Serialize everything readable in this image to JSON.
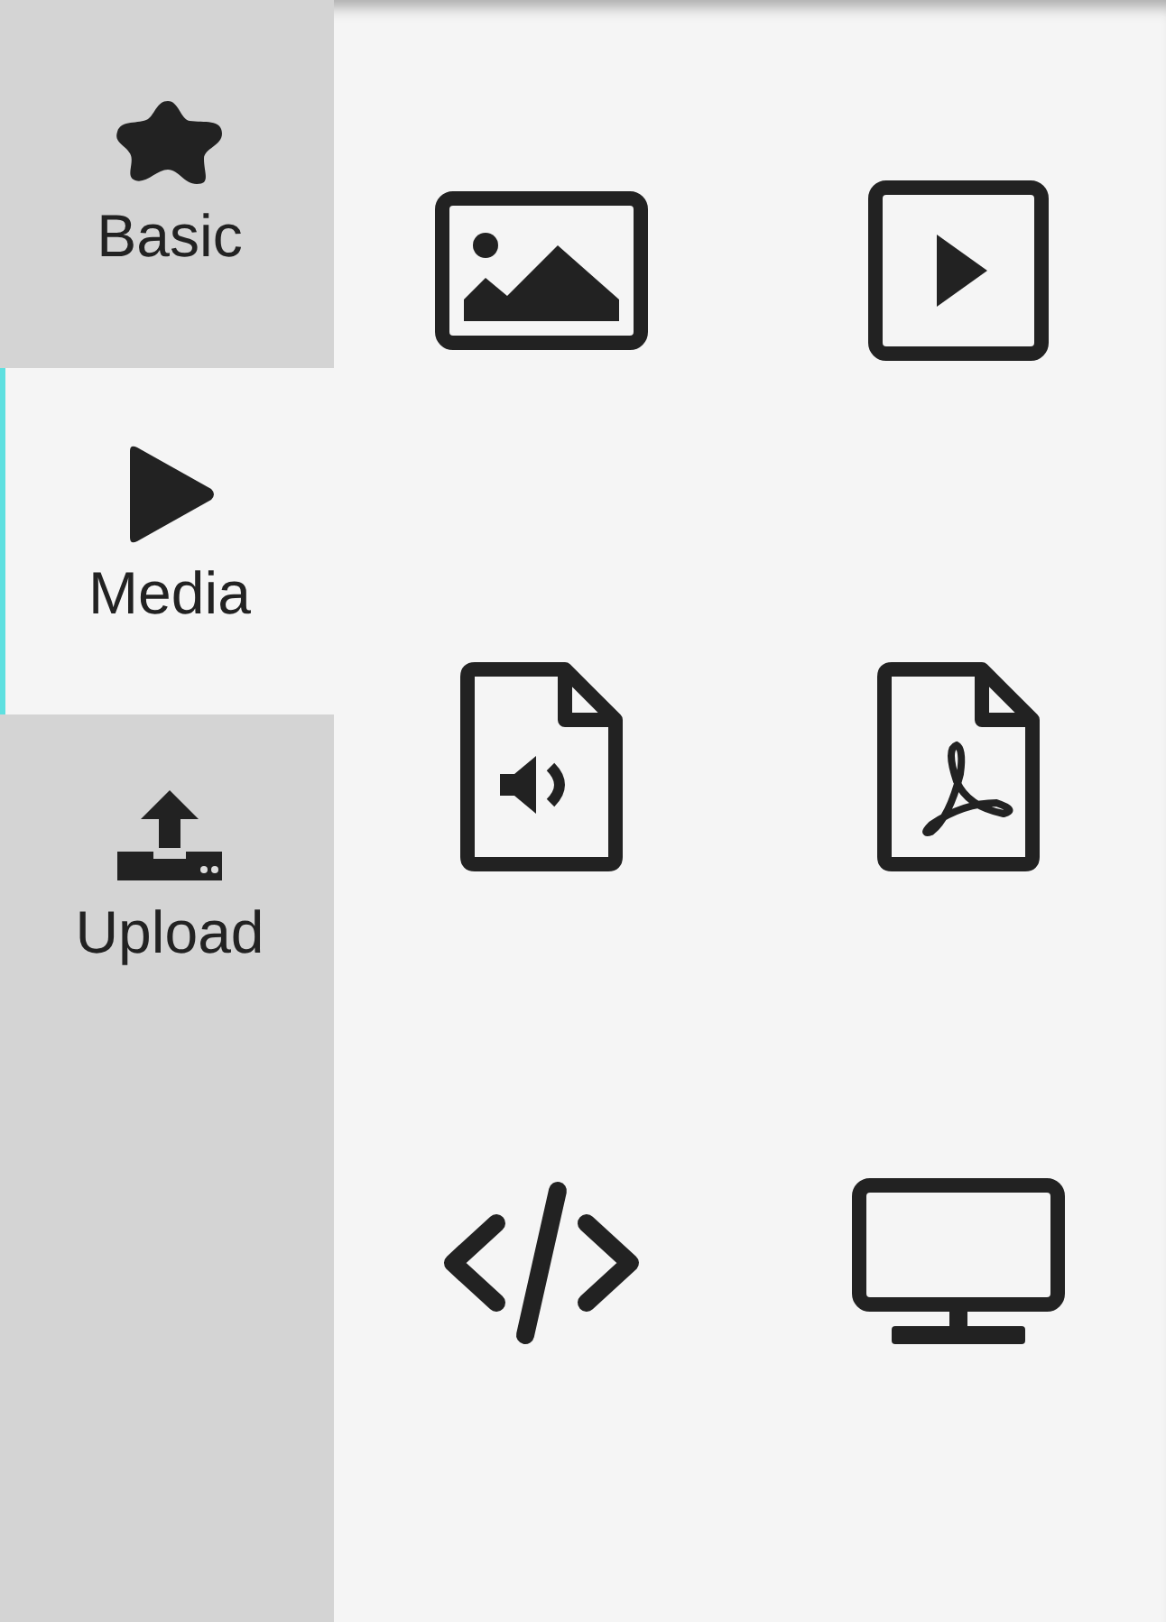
{
  "tabs": [
    {
      "label": "Basic",
      "selected": false
    },
    {
      "label": "Media",
      "selected": true
    },
    {
      "label": "Upload",
      "selected": false
    }
  ]
}
